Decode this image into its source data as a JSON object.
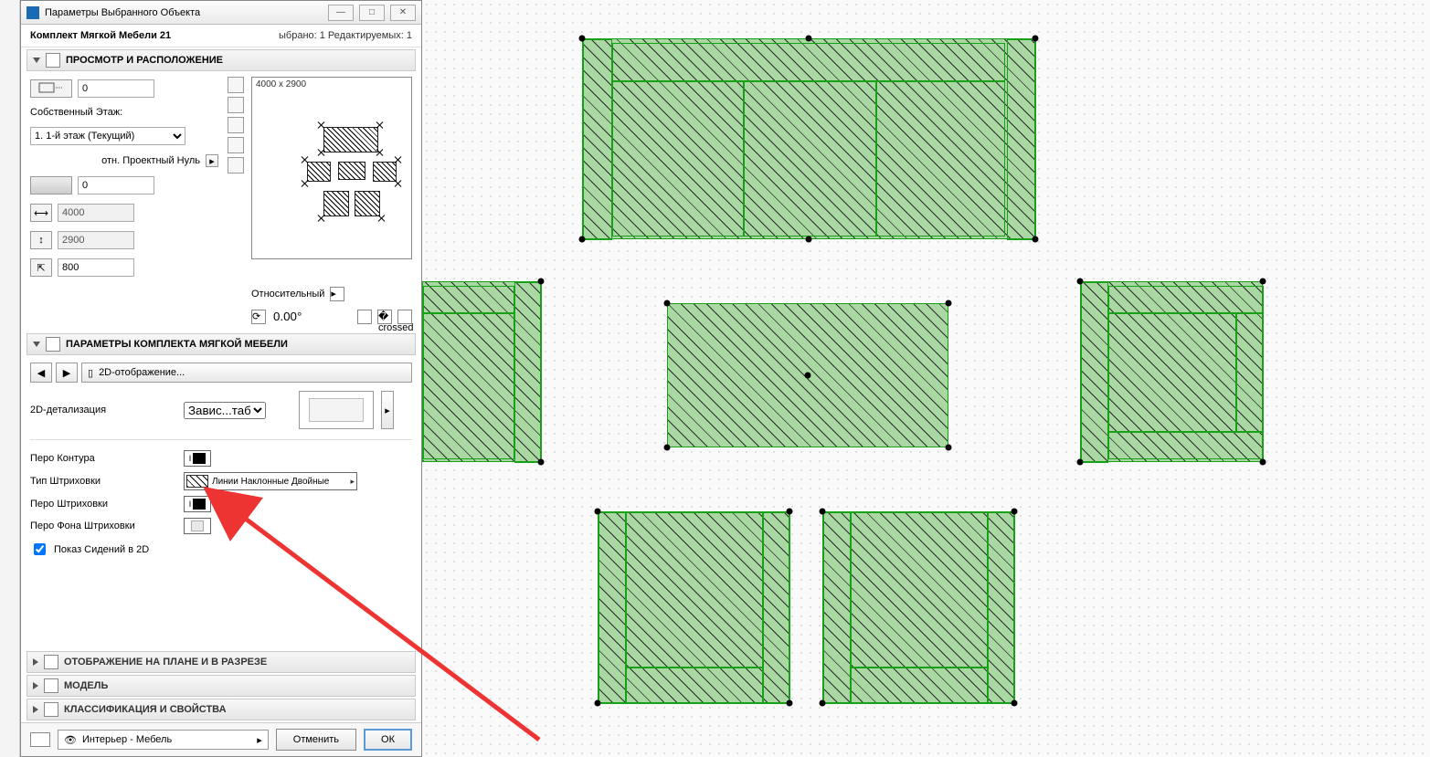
{
  "title": "Параметры Выбранного Объекта",
  "object_name": "Комплект Мягкой Мебели 21",
  "selection_status": "ыбрано: 1 Редактируемых: 1",
  "sections": {
    "preview": "ПРОСМОТР И РАСПОЛОЖЕНИЕ",
    "params": "ПАРАМЕТРЫ КОМПЛЕКТА МЯГКОЙ МЕБЕЛИ",
    "plan": "ОТОБРАЖЕНИЕ НА ПЛАНЕ И В РАЗРЕЗЕ",
    "model": "МОДЕЛЬ",
    "class": "КЛАССИФИКАЦИЯ И СВОЙСТВА"
  },
  "nav_tab": "2D-отображение...",
  "preview_size": "4000 x 2900",
  "placement": {
    "elev_top": "0",
    "story_label": "Собственный Этаж:",
    "story_value": "1. 1-й этаж (Текущий)",
    "ref_label": "отн. Проектный Нуль",
    "elev_bottom": "0",
    "dim_x": "4000",
    "dim_y": "2900",
    "dim_z": "800"
  },
  "angle": {
    "label": "Относительный",
    "value": "0.00°"
  },
  "detail": {
    "label": "2D-детализация",
    "value": "Завис...таба"
  },
  "pens": {
    "contour": "Перо Контура",
    "hatch_type": "Тип Штриховки",
    "hatch_name": "Линии Наклонные Двойные",
    "hatch_pen": "Перо Штриховки",
    "hatch_bg": "Перо Фона Штриховки",
    "show_seats": "Показ Сидений в 2D"
  },
  "footer": {
    "layer": "Интерьер - Мебель",
    "cancel": "Отменить",
    "ok": "ОК"
  }
}
